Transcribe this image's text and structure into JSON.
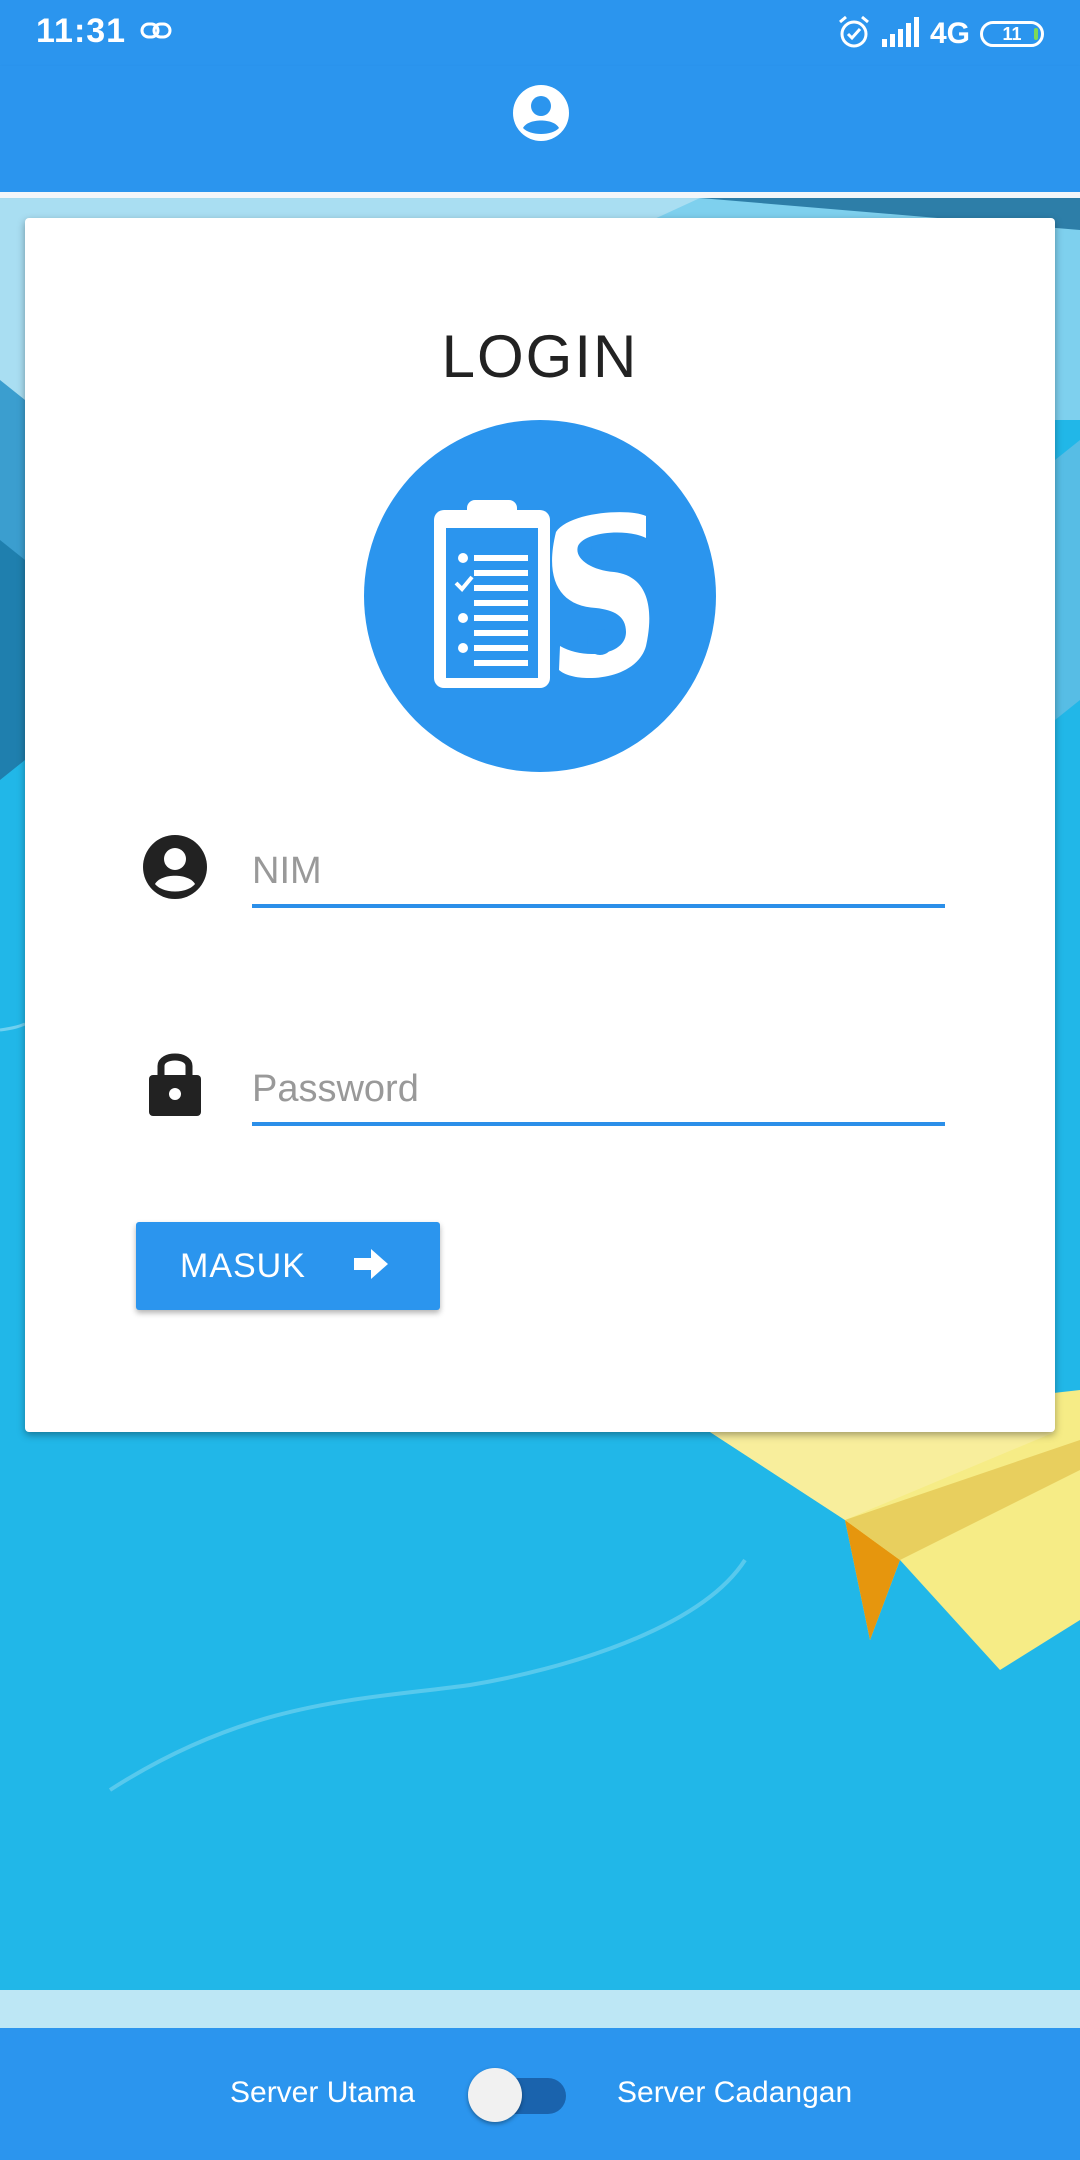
{
  "status_bar": {
    "time": "11:31",
    "network": "4G",
    "battery": "11"
  },
  "app_bar": {
    "icon": "account-circle-icon"
  },
  "login": {
    "title": "LOGIN",
    "logo": "clipboard-logo-icon",
    "nim_placeholder": "NIM",
    "password_placeholder": "Password",
    "submit_label": "MASUK"
  },
  "server_switch": {
    "left_label": "Server Utama",
    "right_label": "Server Cadangan",
    "enabled": false
  },
  "colors": {
    "primary": "#2b95ee",
    "background": "#22b6e6",
    "toggle_track": "#1a63ad"
  }
}
